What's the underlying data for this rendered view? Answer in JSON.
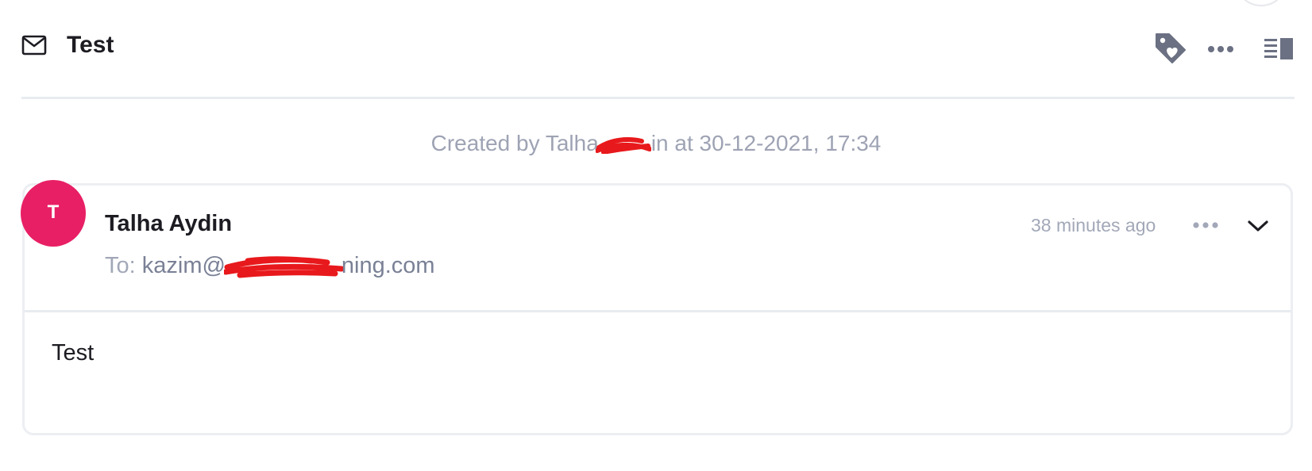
{
  "header": {
    "subject": "Test",
    "icons": {
      "mail": "mail-icon",
      "tag": "tag-heart-icon",
      "more": "more-horizontal-icon",
      "sidebar": "sidebar-toggle-icon"
    }
  },
  "activity": {
    "created_prefix": "Created by Talha",
    "created_suffix": "in at 30-12-2021, 17:34"
  },
  "message": {
    "avatar_initial": "T",
    "sender_name": "Talha Aydin",
    "to_label": "To:",
    "recipient_prefix": "kazim@",
    "recipient_suffix": "ning.com",
    "time_ago": "38 minutes ago",
    "body": "Test",
    "icons": {
      "more": "more-horizontal-icon",
      "expand": "chevron-down-icon"
    }
  },
  "colors": {
    "avatar_bg": "#e81f64",
    "redaction": "#e8191c",
    "muted_text": "#9ea3b4",
    "icon_gray": "#6b7083"
  }
}
